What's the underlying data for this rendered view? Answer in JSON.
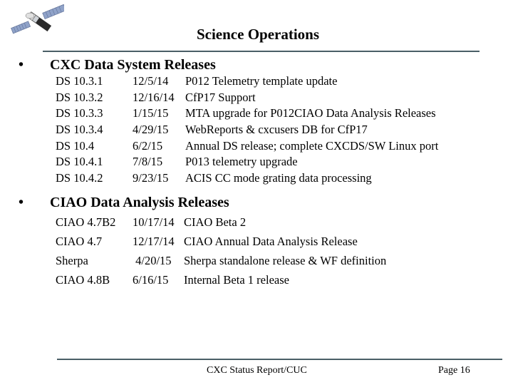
{
  "header": {
    "logo_icon": "satellite-icon",
    "title": "Science Operations"
  },
  "sections": [
    {
      "bullet": "•",
      "heading": "CXC Data System Releases",
      "rows": [
        {
          "name": "DS 10.3.1",
          "date": "12/5/14",
          "description": "P012 Telemetry template update"
        },
        {
          "name": "DS 10.3.2",
          "date": "12/16/14",
          "description": "CfP17 Support"
        },
        {
          "name": "DS 10.3.3",
          "date": "1/15/15",
          "description": "MTA upgrade for P012CIAO Data Analysis Releases"
        },
        {
          "name": "DS 10.3.4",
          "date": "4/29/15",
          "description": "WebReports & cxcusers DB for CfP17"
        },
        {
          "name": "DS 10.4",
          "date": "6/2/15",
          "description": "Annual DS release; complete CXCDS/SW Linux port"
        },
        {
          "name": "DS 10.4.1",
          "date": "7/8/15",
          "description": "P013 telemetry upgrade"
        },
        {
          "name": "DS 10.4.2",
          "date": "9/23/15",
          "description": "ACIS CC mode grating data processing"
        }
      ]
    },
    {
      "bullet": "•",
      "heading": "CIAO Data Analysis Releases",
      "rows": [
        {
          "name": "CIAO 4.7B2",
          "date": "10/17/14",
          "description": "CIAO Beta 2"
        },
        {
          "name": "CIAO 4.7",
          "date": "12/17/14",
          "description": "CIAO Annual Data Analysis Release"
        },
        {
          "name": "Sherpa",
          "date": " 4/20/15",
          "description": "Sherpa standalone release & WF definition"
        },
        {
          "name": "CIAO 4.8B",
          "date": "6/16/15",
          "description": "Internal Beta 1 release"
        }
      ]
    }
  ],
  "footer": {
    "center_text": "CXC Status Report/CUC",
    "page_label": "Page 16"
  },
  "colors": {
    "rule": "#4a5f66",
    "text": "#000000",
    "background": "#ffffff"
  }
}
